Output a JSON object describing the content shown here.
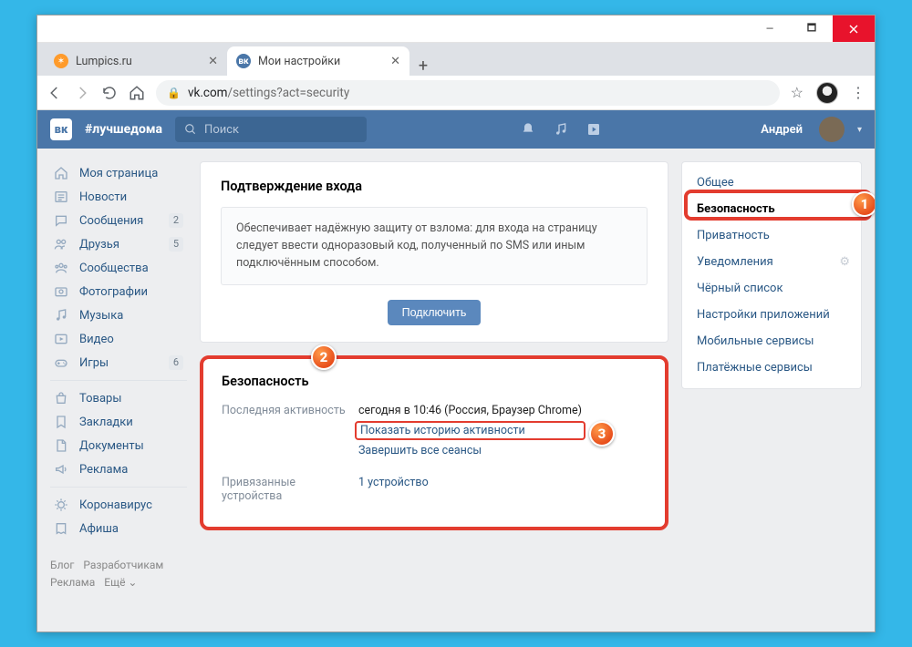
{
  "window": {
    "minimize": "—",
    "maximize": "🗖"
  },
  "tabs": [
    {
      "title": "Lumpics.ru",
      "fav_bg": "#ff9b2b"
    },
    {
      "title": "Мои настройки",
      "fav_label": "вк",
      "fav_bg": "#4a76a8"
    }
  ],
  "omnibox": {
    "host": "vk.com",
    "path": "/settings?act=security"
  },
  "vk": {
    "logo": "вк",
    "hash": "#лучшедома",
    "search_placeholder": "Поиск",
    "username": "Андрей"
  },
  "leftnav": {
    "groups": [
      [
        {
          "label": "Моя страница",
          "icon": "home"
        },
        {
          "label": "Новости",
          "icon": "news"
        },
        {
          "label": "Сообщения",
          "icon": "msg",
          "badge": "2"
        },
        {
          "label": "Друзья",
          "icon": "friends",
          "badge": "5"
        },
        {
          "label": "Сообщества",
          "icon": "groups"
        },
        {
          "label": "Фотографии",
          "icon": "photo"
        },
        {
          "label": "Музыка",
          "icon": "music"
        },
        {
          "label": "Видео",
          "icon": "video"
        },
        {
          "label": "Игры",
          "icon": "games",
          "badge": "6"
        }
      ],
      [
        {
          "label": "Товары",
          "icon": "market"
        },
        {
          "label": "Закладки",
          "icon": "bookmark"
        },
        {
          "label": "Документы",
          "icon": "docs"
        },
        {
          "label": "Реклама",
          "icon": "ads"
        }
      ],
      [
        {
          "label": "Коронавирус",
          "icon": "virus"
        },
        {
          "label": "Афиша",
          "icon": "afisha"
        }
      ]
    ],
    "footer": {
      "blog": "Блог",
      "dev": "Разработчикам",
      "ads": "Реклама",
      "more": "Ещё ⌄"
    }
  },
  "center": {
    "confirm_title": "Подтверждение входа",
    "confirm_text": "Обеспечивает надёжную защиту от взлома: для входа на страницу следует ввести одноразовый код, полученный по SMS или иным подключённым способом.",
    "confirm_btn": "Подключить",
    "security_title": "Безопасность",
    "last_activity_label": "Последняя активность",
    "last_activity_value": "сегодня в 10:46 (Россия, Браузер Chrome)",
    "show_history": "Показать историю активности",
    "end_sessions": "Завершить все сеансы",
    "devices_label": "Привязанные устройства",
    "devices_value": "1 устройство"
  },
  "rightnav": [
    "Общее",
    "Безопасность",
    "Приватность",
    "Уведомления",
    "Чёрный список",
    "Настройки приложений",
    "Мобильные сервисы",
    "Платёжные сервисы"
  ],
  "callouts": {
    "c1": "1",
    "c2": "2",
    "c3": "3"
  }
}
